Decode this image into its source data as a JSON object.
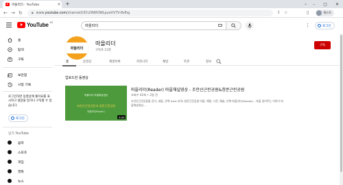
{
  "browser": {
    "tab_title": "마을리더 - YouTube",
    "tab_close": "×",
    "new_tab": "+",
    "url_host": "youtube.com",
    "url_path": "/channel/UCh29WlOWLpuoVV7V-8sfhg",
    "url_prefix": "www.",
    "profile_name": "게스트",
    "window_min": "–",
    "window_max": "▢",
    "window_close": "✕"
  },
  "header": {
    "logo_text": "YouTube",
    "logo_region": "KR",
    "search_value": "마을리더",
    "login_label": "로그인"
  },
  "sidebar": {
    "primary": [
      {
        "label": "홈",
        "icon": "home-icon"
      },
      {
        "label": "탐색",
        "icon": "compass-icon"
      },
      {
        "label": "구독",
        "icon": "subscriptions-icon"
      }
    ],
    "secondary": [
      {
        "label": "보관함",
        "icon": "library-icon"
      },
      {
        "label": "시청 기록",
        "icon": "history-icon"
      }
    ],
    "login_prompt": "로그인하면 동영상에 좋아요를 표시하고 댓글을 달거나 구독할 수 있습니다.",
    "login_label": "로그인",
    "popular_title": "인기 YouTube",
    "popular": [
      {
        "label": "음악",
        "icon": "music-icon"
      },
      {
        "label": "스포츠",
        "icon": "sports-icon"
      },
      {
        "label": "게임",
        "icon": "gaming-icon"
      },
      {
        "label": "영화",
        "icon": "movies-icon"
      },
      {
        "label": "뉴스",
        "icon": "news-icon"
      }
    ]
  },
  "channel": {
    "name": "마을리더",
    "subscribers": "구독자 11명",
    "avatar_text": "마을리더",
    "subscribe_label": "구독",
    "tabs": [
      "홈",
      "동영상",
      "재생목록",
      "커뮤니티",
      "채널",
      "토론",
      "정보"
    ],
    "active_tab": "홈"
  },
  "featured": {
    "section_label": "업로드한 동영상",
    "title": "마을리더(Reader) 마을채널영상 - 조안산근린공원&창문근린공원",
    "meta": "조회수 42회 • 2일 전",
    "description": "조안산근린공원을 걷다, 새들, 산책 (test 부모) 창문근린공원 마을, 해탈, 나뭇, 예술, 산책 마을리더(Reader) - 마을 읽어주는 이야기 마을채널영상...",
    "duration": "3:05",
    "thumb_line1": "마을리더 마을채널영상",
    "thumb_line2": "조안산근린공원 & 창문근린공원",
    "thumb_line3": "마을리더(Reader)"
  },
  "colors": {
    "accent_blue": "#065fd4",
    "youtube_red": "#ff0000",
    "subscribe_red": "#cc0000",
    "thumb_green": "#4c9a3c",
    "avatar_orange": "#f4a21e"
  }
}
